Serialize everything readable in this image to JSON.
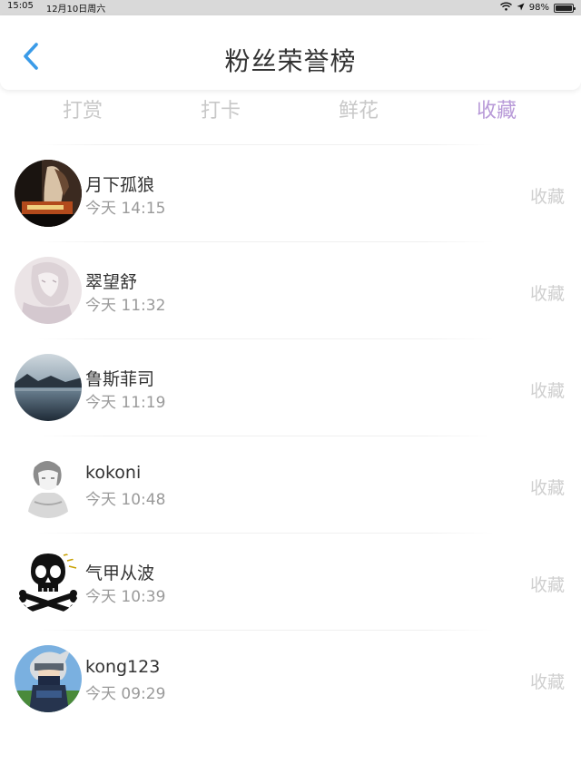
{
  "status_bar": {
    "time": "15:05",
    "date": "12月10日周六",
    "battery_percent": "98%",
    "battery_level": 0.98
  },
  "nav": {
    "back_icon": "chevron-left-icon",
    "title": "粉丝荣誉榜"
  },
  "tabs": [
    {
      "label": "打赏",
      "active": false
    },
    {
      "label": "打卡",
      "active": false
    },
    {
      "label": "鲜花",
      "active": false
    },
    {
      "label": "收藏",
      "active": true
    }
  ],
  "colors": {
    "accent": "#b89ad8",
    "back_arrow": "#3a9be8",
    "inactive_tab": "#c8c8c8"
  },
  "list": [
    {
      "name": "月下孤狼",
      "time": "今天 14:15",
      "action": "收藏"
    },
    {
      "name": "翠望舒",
      "time": "今天 11:32",
      "action": "收藏"
    },
    {
      "name": "鲁斯菲司",
      "time": "今天 11:19",
      "action": "收藏"
    },
    {
      "name": "kokoni",
      "time": "今天 10:48",
      "action": "收藏"
    },
    {
      "name": "气甲从波",
      "time": "今天 10:39",
      "action": "收藏"
    },
    {
      "name": "kong123",
      "time": "今天 09:29",
      "action": "收藏"
    }
  ]
}
